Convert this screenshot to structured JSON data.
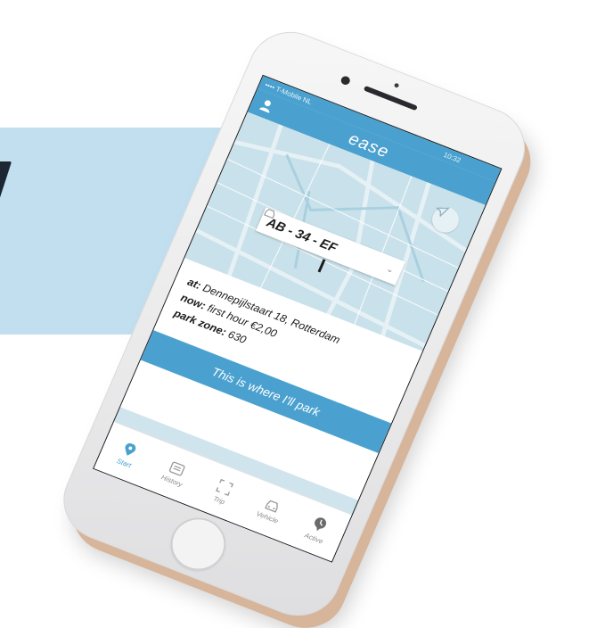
{
  "colors": {
    "brand": "#4aa1cf",
    "accent_bg": "#c2dff0"
  },
  "status_bar": {
    "carrier": "•••• T-Mobile NL",
    "time": "10:32"
  },
  "app": {
    "logo": "ease"
  },
  "map": {
    "plate_number": "AB - 34 - EF"
  },
  "info": {
    "at_label": "at:",
    "at_value": "Dennepijlstaart 18, Rotterdam",
    "now_label": "now:",
    "now_value": "first hour €2,00",
    "zone_label": "park zone:",
    "zone_value": "630"
  },
  "park_button": {
    "label": "This is where I'll park"
  },
  "tabs": [
    {
      "label": "Start",
      "icon": "location-pin-icon"
    },
    {
      "label": "History",
      "icon": "receipt-icon"
    },
    {
      "label": "Trip",
      "icon": "trip-frame-icon"
    },
    {
      "label": "Vehicle",
      "icon": "car-icon"
    },
    {
      "label": "Active",
      "icon": "active-timer-icon"
    }
  ]
}
